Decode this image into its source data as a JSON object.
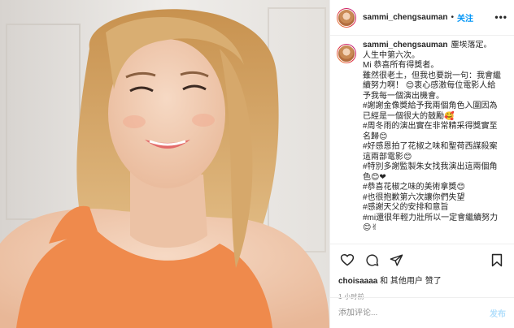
{
  "header": {
    "username": "sammi_chengsauman",
    "separator": "•",
    "follow_label": "关注",
    "more_label": "•••"
  },
  "caption": {
    "username": "sammi_chengsauman",
    "lines": [
      "塵埃落定。",
      "人生中第六次。",
      "Mi 恭喜所有得獎者。",
      "雖然很老土，但我也要說一句：我會繼",
      "續努力啊！ 😊衷心感激每位電影人給",
      "予我每一個演出機會。",
      "#謝謝金像獎給予我兩個角色入圍因為",
      "已經是一個很大的鼓勵🥰",
      "#周冬雨的演出實在非常精采得獎實至",
      "名歸😊",
      "#好感恩拍了花椒之味和聖荷西謀殺案",
      "這兩部電影😊",
      "#特別多謝監製朱女找我演出這兩個角",
      "色😊❤",
      "#恭喜花椒之味的美術拿獎😊",
      "#也很抱歉第六次讓你們失望",
      "#感謝天父的安排和意旨",
      "#mi還很年輕力壯所以一定會繼續努力",
      "😊✌"
    ]
  },
  "actions": {
    "like_icon": "heart-outline-icon",
    "comment_icon": "comment-bubble-icon",
    "share_icon": "paper-plane-icon",
    "save_icon": "bookmark-icon"
  },
  "likes": {
    "user": "choisaaaa",
    "text": " 和 其他用户 赞了"
  },
  "time": "1 小时前",
  "comment_box": {
    "placeholder": "添加评论...",
    "post_label": "发布"
  },
  "colors": {
    "link": "#0095f6",
    "border": "#efefef",
    "muted": "#8e8e8e",
    "post_disabled": "#b2dffc"
  }
}
